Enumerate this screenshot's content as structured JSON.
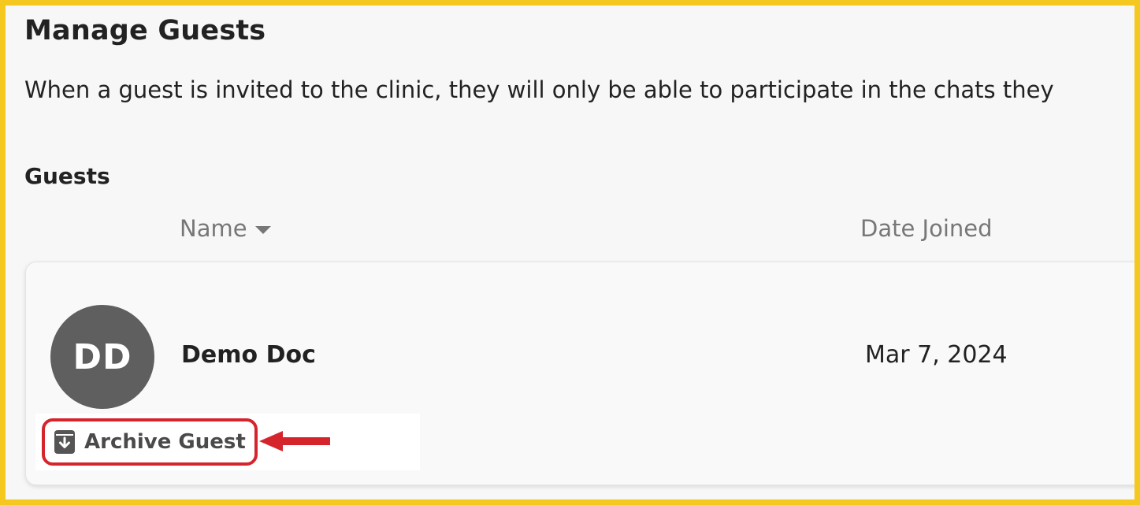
{
  "header": {
    "title": "Manage Guests",
    "description": "When a guest is invited to the clinic, they will only be able to participate in the chats they"
  },
  "guests": {
    "section_title": "Guests",
    "columns": {
      "name": "Name",
      "date_joined": "Date Joined"
    },
    "rows": [
      {
        "initials": "DD",
        "name": "Demo Doc",
        "date_joined": "Mar 7, 2024"
      }
    ],
    "archive_label": "Archive Guest"
  },
  "colors": {
    "frame": "#f5c81f",
    "avatar": "#5f5f5f",
    "highlight": "#d6242d"
  },
  "icons": {
    "sort": "caret-down-icon",
    "archive": "archive-box-icon",
    "annotation": "red-arrow-icon"
  }
}
